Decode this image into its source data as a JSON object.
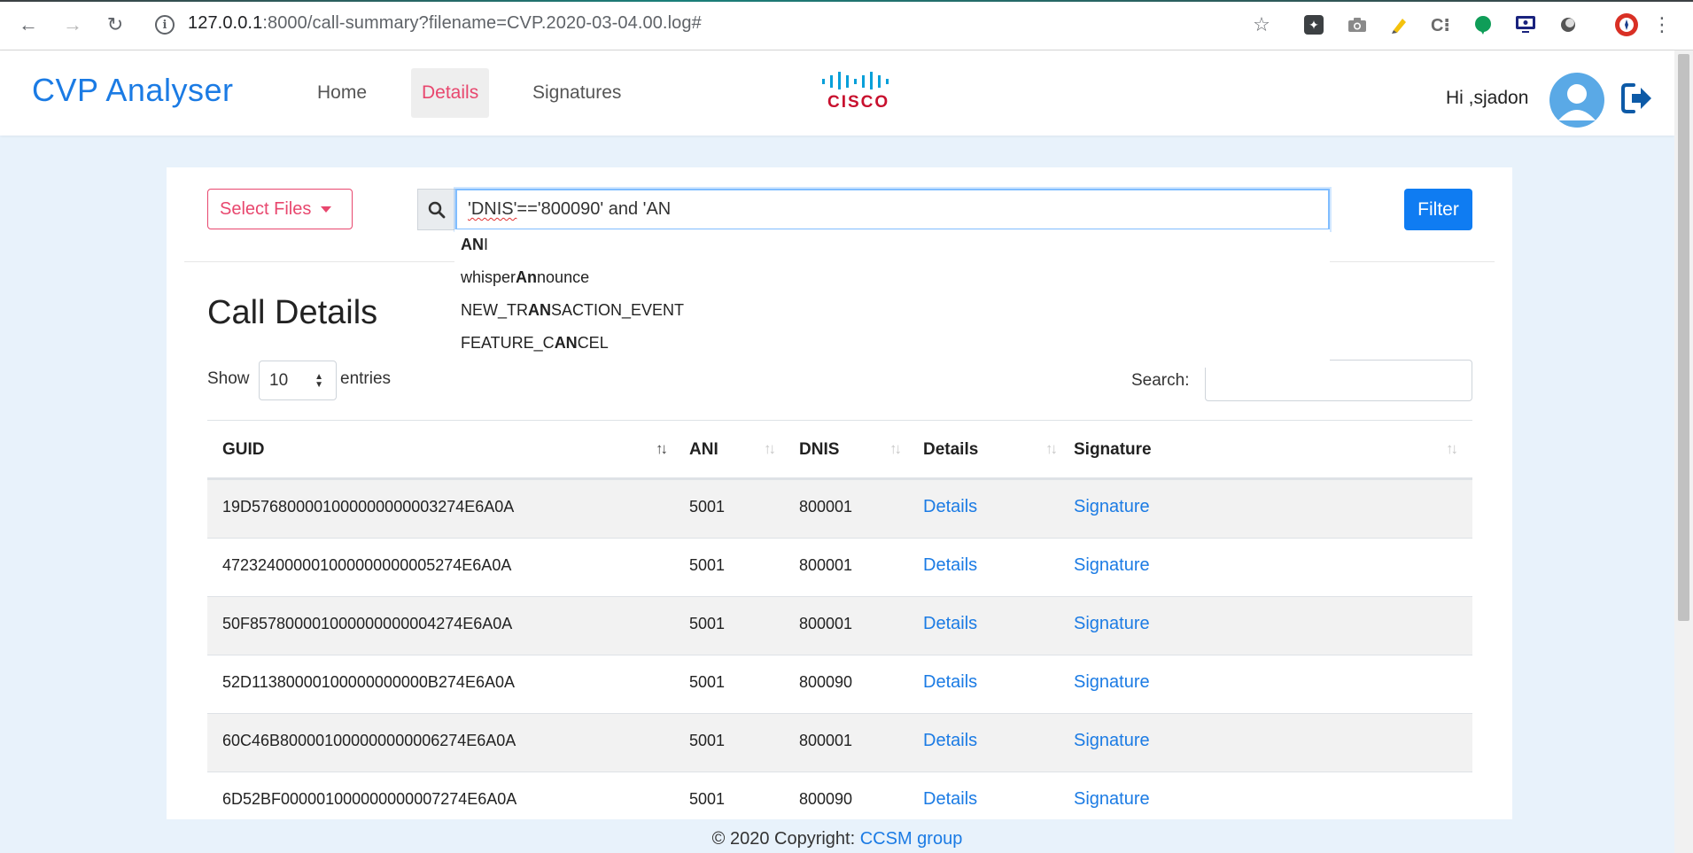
{
  "browser": {
    "url_host": "127.0.0.1",
    "url_path": ":8000/call-summary?filename=CVP.2020-03-04.00.log#"
  },
  "navbar": {
    "brand": "CVP Analyser",
    "links": [
      {
        "label": "Home"
      },
      {
        "label": "Details",
        "active": true
      },
      {
        "label": "Signatures"
      }
    ],
    "logo_text": "CISCO",
    "greeting": "Hi ,sjadon"
  },
  "toolbar": {
    "select_files": "Select Files",
    "query_part1": "'DNIS'",
    "query_part2": "=='800090' and 'AN",
    "filter_label": "Filter"
  },
  "autocomplete": [
    {
      "pre": "",
      "match": "AN",
      "post": "I"
    },
    {
      "pre": "whisper",
      "match": "An",
      "post": "nounce"
    },
    {
      "pre": "NEW_TR",
      "match": "AN",
      "post": "SACTION_EVENT"
    },
    {
      "pre": "FEATURE_C",
      "match": "AN",
      "post": "CEL"
    }
  ],
  "section": {
    "title": "Call Details",
    "show_label": "Show",
    "entries_value": "10",
    "entries_label": "entries",
    "search_label": "Search:"
  },
  "table": {
    "headers": [
      "GUID",
      "ANI",
      "DNIS",
      "Details",
      "Signature"
    ],
    "rows": [
      {
        "guid": "19D576800001000000000003274E6A0A",
        "ani": "5001",
        "dnis": "800001",
        "details": "Details",
        "signature": "Signature"
      },
      {
        "guid": "472324000001000000000005274E6A0A",
        "ani": "5001",
        "dnis": "800001",
        "details": "Details",
        "signature": "Signature"
      },
      {
        "guid": "50F857800001000000000004274E6A0A",
        "ani": "5001",
        "dnis": "800001",
        "details": "Details",
        "signature": "Signature"
      },
      {
        "guid": "52D11380000100000000000B274E6A0A",
        "ani": "5001",
        "dnis": "800090",
        "details": "Details",
        "signature": "Signature"
      },
      {
        "guid": "60C46B800001000000000006274E6A0A",
        "ani": "5001",
        "dnis": "800001",
        "details": "Details",
        "signature": "Signature"
      },
      {
        "guid": "6D52BF000001000000000007274E6A0A",
        "ani": "5001",
        "dnis": "800090",
        "details": "Details",
        "signature": "Signature"
      }
    ]
  },
  "footer": {
    "copyright": "© 2020 Copyright: ",
    "org": "CCSM group"
  },
  "colors": {
    "brand_blue": "#1b7be4",
    "accent_pink": "#e8476e",
    "filter_blue": "#0f7cf2"
  }
}
